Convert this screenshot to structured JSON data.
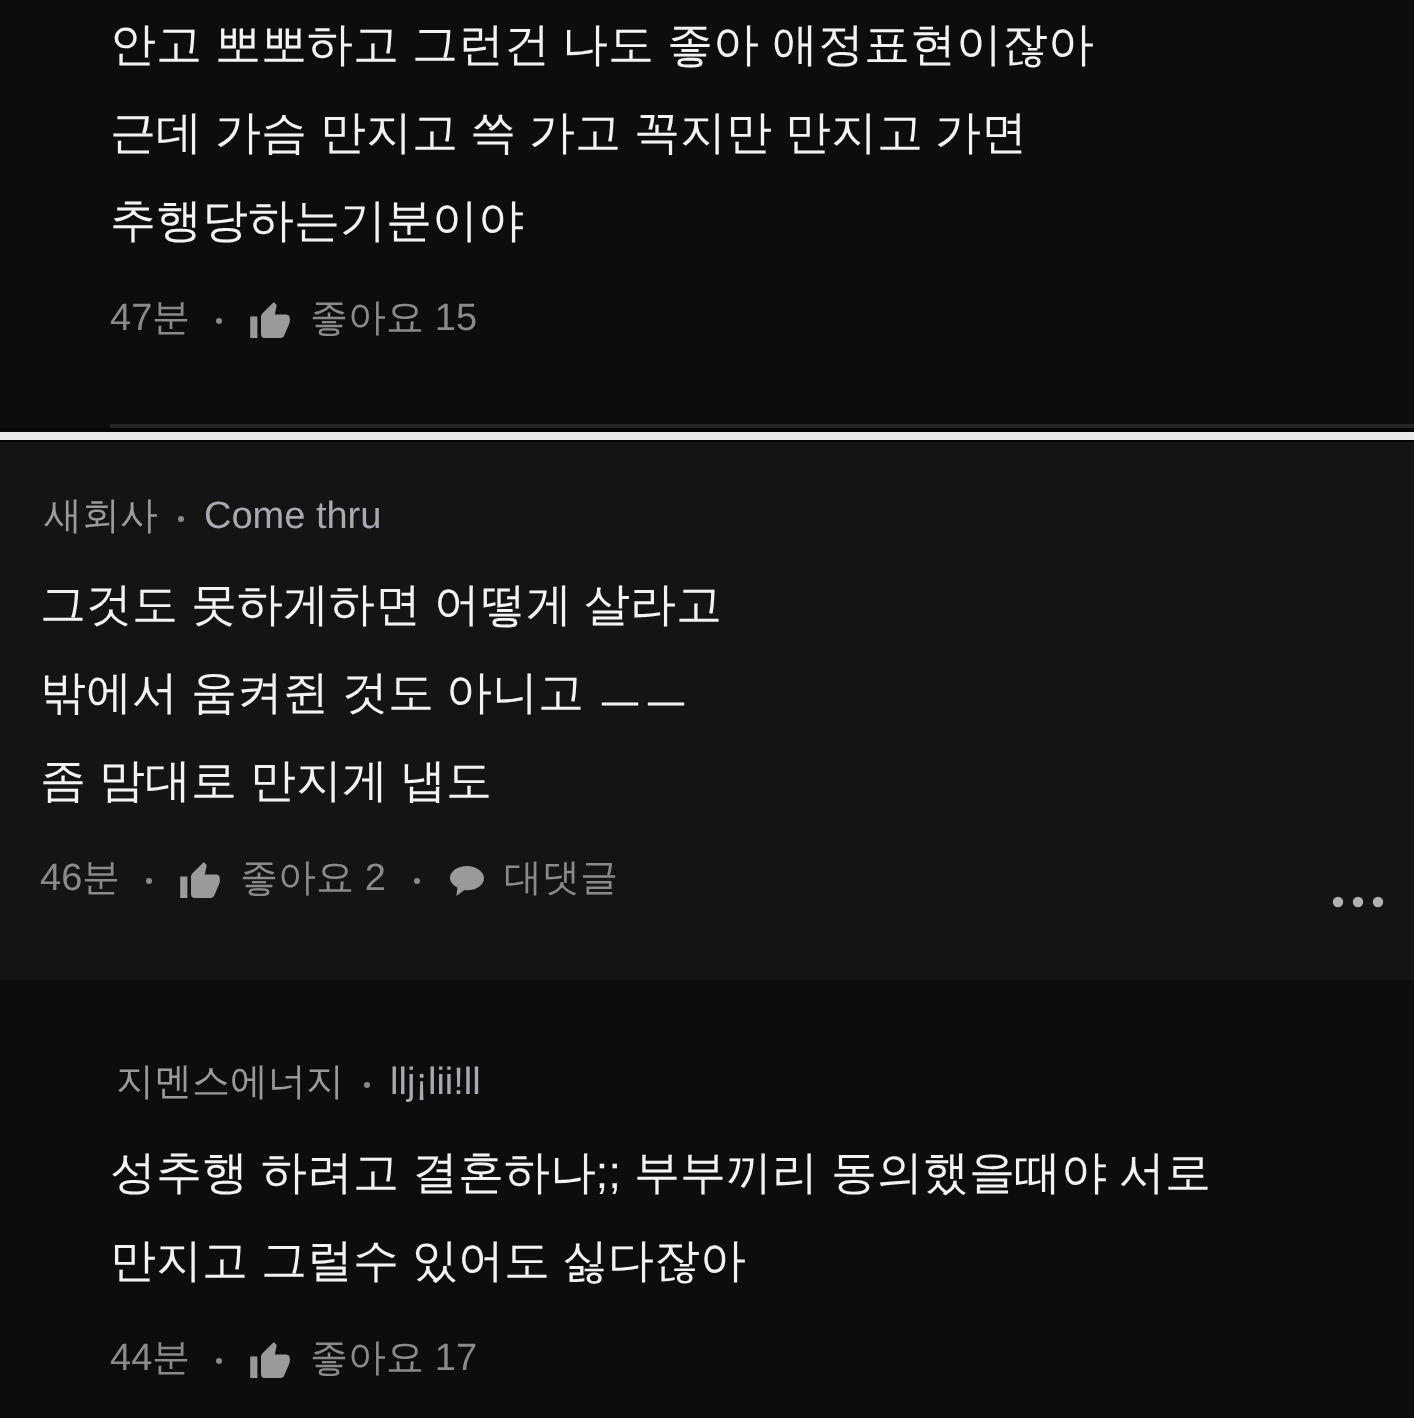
{
  "comments": [
    {
      "kind": "reply",
      "text": "안고 뽀뽀하고 그런건 나도 좋아 애정표현이잖아\n근데 가슴 만지고 쓱 가고 꼭지만 만지고 가면\n추행당하는기분이야",
      "time": "47분",
      "likes": "좋아요 15"
    },
    {
      "kind": "comment",
      "company": "새회사",
      "nickname": "Come thru",
      "text": "그것도 못하게하면 어떻게 살라고\n밖에서 움켜쥔 것도 아니고 ㅡㅡ\n좀 맘대로 만지게 냅도",
      "time": "46분",
      "likes": "좋아요 2",
      "reply_label": "대댓글"
    },
    {
      "kind": "reply",
      "company": "지멘스에너지",
      "nickname": "llj¡lii!ll",
      "text": "성추행 하려고 결혼하나;; 부부끼리 동의했을때야 서로\n만지고 그럴수 있어도 싫다잖아",
      "time": "44분",
      "likes": "좋아요 17"
    }
  ]
}
